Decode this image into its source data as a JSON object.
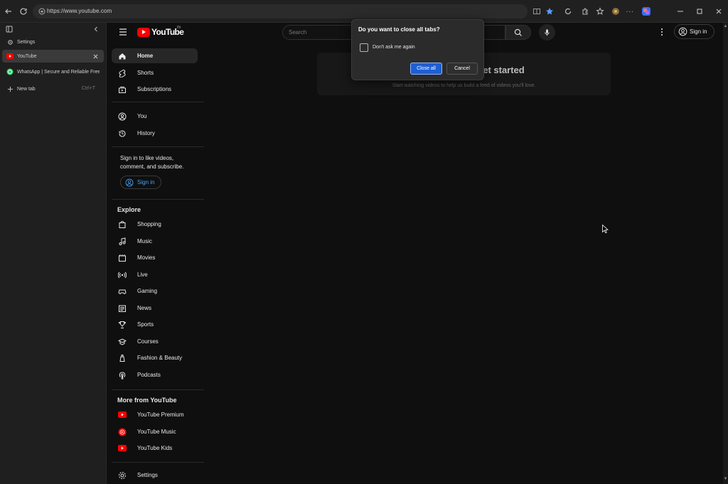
{
  "browser": {
    "url": "https://www.youtube.com",
    "tabs": [
      {
        "label": "Settings",
        "icon": "gear-icon"
      },
      {
        "label": "YouTube",
        "icon": "youtube-icon",
        "active": true
      },
      {
        "label": "WhatsApp | Secure and Reliable Free",
        "icon": "whatsapp-icon"
      }
    ],
    "new_tab": {
      "label": "New tab",
      "shortcut": "Ctrl+T"
    }
  },
  "youtube": {
    "logo_text": "YouTube",
    "country_code": "IN",
    "search_placeholder": "Search",
    "sign_in_label": "Sign in",
    "sidebar": {
      "main": [
        {
          "label": "Home",
          "icon": "home-icon",
          "active": true
        },
        {
          "label": "Shorts",
          "icon": "shorts-icon"
        },
        {
          "label": "Subscriptions",
          "icon": "subscriptions-icon"
        }
      ],
      "you": [
        {
          "label": "You",
          "icon": "you-icon"
        },
        {
          "label": "History",
          "icon": "history-icon"
        }
      ],
      "signin_note": "Sign in to like videos, comment, and subscribe.",
      "signin_button": "Sign in",
      "explore_heading": "Explore",
      "explore": [
        {
          "label": "Shopping",
          "icon": "shopping-icon"
        },
        {
          "label": "Music",
          "icon": "music-icon"
        },
        {
          "label": "Movies",
          "icon": "movies-icon"
        },
        {
          "label": "Live",
          "icon": "live-icon"
        },
        {
          "label": "Gaming",
          "icon": "gaming-icon"
        },
        {
          "label": "News",
          "icon": "news-icon"
        },
        {
          "label": "Sports",
          "icon": "sports-icon"
        },
        {
          "label": "Courses",
          "icon": "courses-icon"
        },
        {
          "label": "Fashion & Beauty",
          "icon": "fashion-icon"
        },
        {
          "label": "Podcasts",
          "icon": "podcasts-icon"
        }
      ],
      "more_heading": "More from YouTube",
      "more": [
        {
          "label": "YouTube Premium",
          "icon": "youtube-premium-icon"
        },
        {
          "label": "YouTube Music",
          "icon": "youtube-music-icon"
        },
        {
          "label": "YouTube Kids",
          "icon": "youtube-kids-icon"
        }
      ],
      "settings": {
        "label": "Settings",
        "icon": "settings-icon"
      }
    },
    "empty_state": {
      "title": "Try searching to get started",
      "subtitle": "Start watching videos to help us build a feed of videos you'll love."
    }
  },
  "dialog": {
    "title": "Do you want to close all tabs?",
    "checkbox_label": "Don't ask me again",
    "checkbox_checked": false,
    "confirm_label": "Close all",
    "cancel_label": "Cancel"
  },
  "colors": {
    "accent_blue": "#1e5fd6",
    "youtube_red": "#ff0000",
    "link_blue": "#3ea6ff",
    "background": "#0f0f0f"
  }
}
